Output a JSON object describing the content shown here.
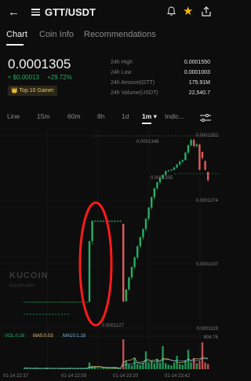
{
  "header": {
    "pair": "GTT/USDT",
    "back_icon": "arrow-left-icon",
    "menu_icon": "menu-icon",
    "alarm_icon": "alarm-icon",
    "star_icon": "star-icon",
    "share_icon": "share-icon"
  },
  "tabs": [
    {
      "label": "Chart"
    },
    {
      "label": "Coin Info"
    },
    {
      "label": "Recommendations"
    }
  ],
  "ticker": {
    "price": "0.0001305",
    "fiat": "≈ $0.00013",
    "change": "+29.72%",
    "badge": "Top 10 Gainer",
    "badge_icon": "crown-icon"
  },
  "stats": [
    {
      "label": "24h High",
      "value": "0.0001550"
    },
    {
      "label": "24h Low",
      "value": "0.0001003"
    },
    {
      "label": "24h Amount(GTT)",
      "value": "175.91M"
    },
    {
      "label": "24h Volume(USDT)",
      "value": "22,540.7"
    }
  ],
  "intervals": [
    "Line",
    "15m",
    "60m",
    "8h",
    "1d",
    "1m ▾",
    "Indic..."
  ],
  "chart_labels": {
    "y_ticks": [
      "0.0001352",
      "0.0001274",
      "0.0001197",
      "0.0001119",
      "804.76"
    ],
    "high_marker": "0.0001348",
    "last_marker": "0.0001305",
    "low_marker": "0.0001127",
    "x_ticks": [
      "01-14 22:37",
      "01-14 22:59",
      "01-14 23:20",
      "01-14 23:42"
    ],
    "watermark": "KUCOIN",
    "watermark_url": "Kucoin.com",
    "vol": "VOL:0.16",
    "ma5": "MA5:0.03",
    "ma10": "MA10:1.18"
  },
  "colors": {
    "up": "#24ae64",
    "down": "#e05c5c",
    "annotation": "#ff0000",
    "ma5": "#e9c46a",
    "ma10": "#6ec1e4"
  },
  "chart_data": {
    "type": "candlestick",
    "interval": "1m",
    "overlay": "red oval annotation around the spike candle",
    "candles": [
      {
        "o": 0.0001128,
        "h": 0.0001128,
        "l": 0.0001128,
        "c": 0.0001128
      },
      {
        "o": 0.0001128,
        "h": 0.0001128,
        "l": 0.0001128,
        "c": 0.0001128
      },
      {
        "o": 0.0001128,
        "h": 0.0001128,
        "l": 0.0001128,
        "c": 0.0001128
      },
      {
        "o": 0.0001128,
        "h": 0.0001128,
        "l": 0.0001128,
        "c": 0.0001128
      },
      {
        "o": 0.0001128,
        "h": 0.0001128,
        "l": 0.0001128,
        "c": 0.0001128
      },
      {
        "o": 0.0001128,
        "h": 0.0001128,
        "l": 0.0001128,
        "c": 0.0001128
      },
      {
        "o": 0.0001128,
        "h": 0.0001128,
        "l": 0.0001128,
        "c": 0.0001128
      },
      {
        "o": 0.0001128,
        "h": 0.0001128,
        "l": 0.0001128,
        "c": 0.0001128
      },
      {
        "o": 0.0001128,
        "h": 0.0001128,
        "l": 0.0001128,
        "c": 0.0001128
      },
      {
        "o": 0.0001128,
        "h": 0.0001128,
        "l": 0.0001128,
        "c": 0.0001128
      },
      {
        "o": 0.0001128,
        "h": 0.0001128,
        "l": 0.0001128,
        "c": 0.0001128
      },
      {
        "o": 0.0001128,
        "h": 0.0001128,
        "l": 0.0001128,
        "c": 0.0001128
      },
      {
        "o": 0.0001128,
        "h": 0.0001128,
        "l": 0.0001128,
        "c": 0.0001128
      },
      {
        "o": 0.0001128,
        "h": 0.0001128,
        "l": 0.0001128,
        "c": 0.0001128
      },
      {
        "o": 0.0001128,
        "h": 0.0001128,
        "l": 0.0001128,
        "c": 0.0001128
      },
      {
        "o": 0.0001128,
        "h": 0.0001128,
        "l": 0.0001128,
        "c": 0.0001128
      },
      {
        "o": 0.0001128,
        "h": 0.0001128,
        "l": 0.0001128,
        "c": 0.0001128
      },
      {
        "o": 0.0001128,
        "h": 0.0001128,
        "l": 0.0001128,
        "c": 0.0001128
      },
      {
        "o": 0.0001128,
        "h": 0.0001128,
        "l": 0.0001128,
        "c": 0.0001128
      },
      {
        "o": 0.0001128,
        "h": 0.0001128,
        "l": 0.0001128,
        "c": 0.0001128
      },
      {
        "o": 0.0001128,
        "h": 0.0001128,
        "l": 0.0001128,
        "c": 0.0001128
      },
      {
        "o": 0.0001128,
        "h": 0.0001128,
        "l": 0.0001128,
        "c": 0.0001128
      },
      {
        "o": 0.0001128,
        "h": 0.0001128,
        "l": 0.0001128,
        "c": 0.0001128
      },
      {
        "o": 0.0001128,
        "h": 0.000121,
        "l": 0.0001128,
        "c": 0.000121
      },
      {
        "o": 0.000121,
        "h": 0.0001238,
        "l": 0.0001205,
        "c": 0.0001237
      },
      {
        "o": 0.0001236,
        "h": 0.0001238,
        "l": 0.0001236,
        "c": 0.0001237
      },
      {
        "o": 0.0001236,
        "h": 0.0001238,
        "l": 0.0001236,
        "c": 0.0001237
      },
      {
        "o": 0.0001236,
        "h": 0.0001238,
        "l": 0.0001236,
        "c": 0.0001237
      },
      {
        "o": 0.0001236,
        "h": 0.0001238,
        "l": 0.0001236,
        "c": 0.0001237
      },
      {
        "o": 0.0001236,
        "h": 0.0001238,
        "l": 0.0001236,
        "c": 0.0001237
      },
      {
        "o": 0.0001236,
        "h": 0.0001238,
        "l": 0.0001236,
        "c": 0.0001237
      },
      {
        "o": 0.0001236,
        "h": 0.0001238,
        "l": 0.0001236,
        "c": 0.0001237
      },
      {
        "o": 0.0001236,
        "h": 0.0001238,
        "l": 0.0001236,
        "c": 0.0001237
      },
      {
        "o": 0.0001236,
        "h": 0.0001238,
        "l": 0.0001236,
        "c": 0.0001237
      },
      {
        "o": 0.0001236,
        "h": 0.0001238,
        "l": 0.0001236,
        "c": 0.0001237
      },
      {
        "o": 0.0001233,
        "h": 0.0001233,
        "l": 0.0001127,
        "c": 0.0001129
      },
      {
        "o": 0.0001129,
        "h": 0.0001145,
        "l": 0.0001128,
        "c": 0.0001145
      },
      {
        "o": 0.0001145,
        "h": 0.0001162,
        "l": 0.0001143,
        "c": 0.0001161
      },
      {
        "o": 0.0001161,
        "h": 0.0001176,
        "l": 0.0001158,
        "c": 0.0001175
      },
      {
        "o": 0.0001175,
        "h": 0.0001189,
        "l": 0.0001172,
        "c": 0.0001188
      },
      {
        "o": 0.0001188,
        "h": 0.0001204,
        "l": 0.0001185,
        "c": 0.0001203
      },
      {
        "o": 0.0001203,
        "h": 0.0001216,
        "l": 0.00012,
        "c": 0.0001215
      },
      {
        "o": 0.0001215,
        "h": 0.0001227,
        "l": 0.0001212,
        "c": 0.0001226
      },
      {
        "o": 0.0001226,
        "h": 0.0001241,
        "l": 0.0001223,
        "c": 0.000124
      },
      {
        "o": 0.000124,
        "h": 0.0001256,
        "l": 0.0001237,
        "c": 0.0001255
      },
      {
        "o": 0.0001255,
        "h": 0.000127,
        "l": 0.0001252,
        "c": 0.0001269
      },
      {
        "o": 0.0001269,
        "h": 0.0001282,
        "l": 0.0001266,
        "c": 0.0001281
      },
      {
        "o": 0.0001281,
        "h": 0.000129,
        "l": 0.0001279,
        "c": 0.0001289
      },
      {
        "o": 0.0001289,
        "h": 0.0001296,
        "l": 0.0001286,
        "c": 0.0001295
      },
      {
        "o": 0.0001295,
        "h": 0.00013,
        "l": 0.0001293,
        "c": 0.0001299
      },
      {
        "o": 0.0001299,
        "h": 0.0001305,
        "l": 0.0001297,
        "c": 0.0001304
      },
      {
        "o": 0.0001304,
        "h": 0.0001306,
        "l": 0.0001303,
        "c": 0.0001305
      },
      {
        "o": 0.0001305,
        "h": 0.0001307,
        "l": 0.0001304,
        "c": 0.0001306
      },
      {
        "o": 0.0001306,
        "h": 0.000131,
        "l": 0.0001305,
        "c": 0.0001309
      },
      {
        "o": 0.0001309,
        "h": 0.0001314,
        "l": 0.0001308,
        "c": 0.0001313
      },
      {
        "o": 0.0001313,
        "h": 0.0001318,
        "l": 0.0001311,
        "c": 0.0001317
      },
      {
        "o": 0.0001317,
        "h": 0.000132,
        "l": 0.0001315,
        "c": 0.0001319
      },
      {
        "o": 0.0001319,
        "h": 0.000133,
        "l": 0.0001318,
        "c": 0.0001329
      },
      {
        "o": 0.0001329,
        "h": 0.000134,
        "l": 0.0001327,
        "c": 0.0001339
      },
      {
        "o": 0.0001339,
        "h": 0.0001348,
        "l": 0.0001337,
        "c": 0.0001346
      },
      {
        "o": 0.0001346,
        "h": 0.0001348,
        "l": 0.0001336,
        "c": 0.0001338
      },
      {
        "o": 0.0001338,
        "h": 0.0001342,
        "l": 0.0001336,
        "c": 0.000134
      },
      {
        "o": 0.000134,
        "h": 0.0001341,
        "l": 0.0001305,
        "c": 0.0001306
      },
      {
        "o": 0.000133,
        "h": 0.000133,
        "l": 0.000132,
        "c": 0.0001322
      },
      {
        "o": 0.0001318,
        "h": 0.0001318,
        "l": 0.0001305,
        "c": 0.0001306
      },
      {
        "o": 0.0001303,
        "h": 0.0001303,
        "l": 0.000129,
        "c": 0.0001292
      }
    ],
    "volume": [
      0.2,
      0.1,
      0.1,
      0.1,
      0.2,
      0.1,
      0.1,
      0.1,
      0.2,
      0.1,
      0.1,
      0.1,
      0.1,
      0.1,
      0.1,
      0.1,
      0.2,
      0.1,
      0.1,
      0.1,
      0.1,
      0.1,
      0.2,
      0.9,
      0.4,
      0.3,
      0.1,
      0.1,
      0.3,
      0.2,
      0.1,
      0.1,
      0.2,
      0.1,
      0.1,
      4.0,
      1.2,
      0.6,
      0.5,
      1.5,
      0.7,
      0.6,
      0.8,
      2.4,
      0.9,
      1.1,
      0.8,
      1.4,
      0.9,
      3.1,
      0.8,
      0.6,
      0.5,
      0.9,
      1.8,
      0.7,
      0.6,
      1.2,
      2.6,
      0.9,
      1.5,
      0.8,
      1.1,
      3.6,
      0.9,
      0.7
    ],
    "ylim": [
      0.0001085,
      0.000136
    ]
  }
}
